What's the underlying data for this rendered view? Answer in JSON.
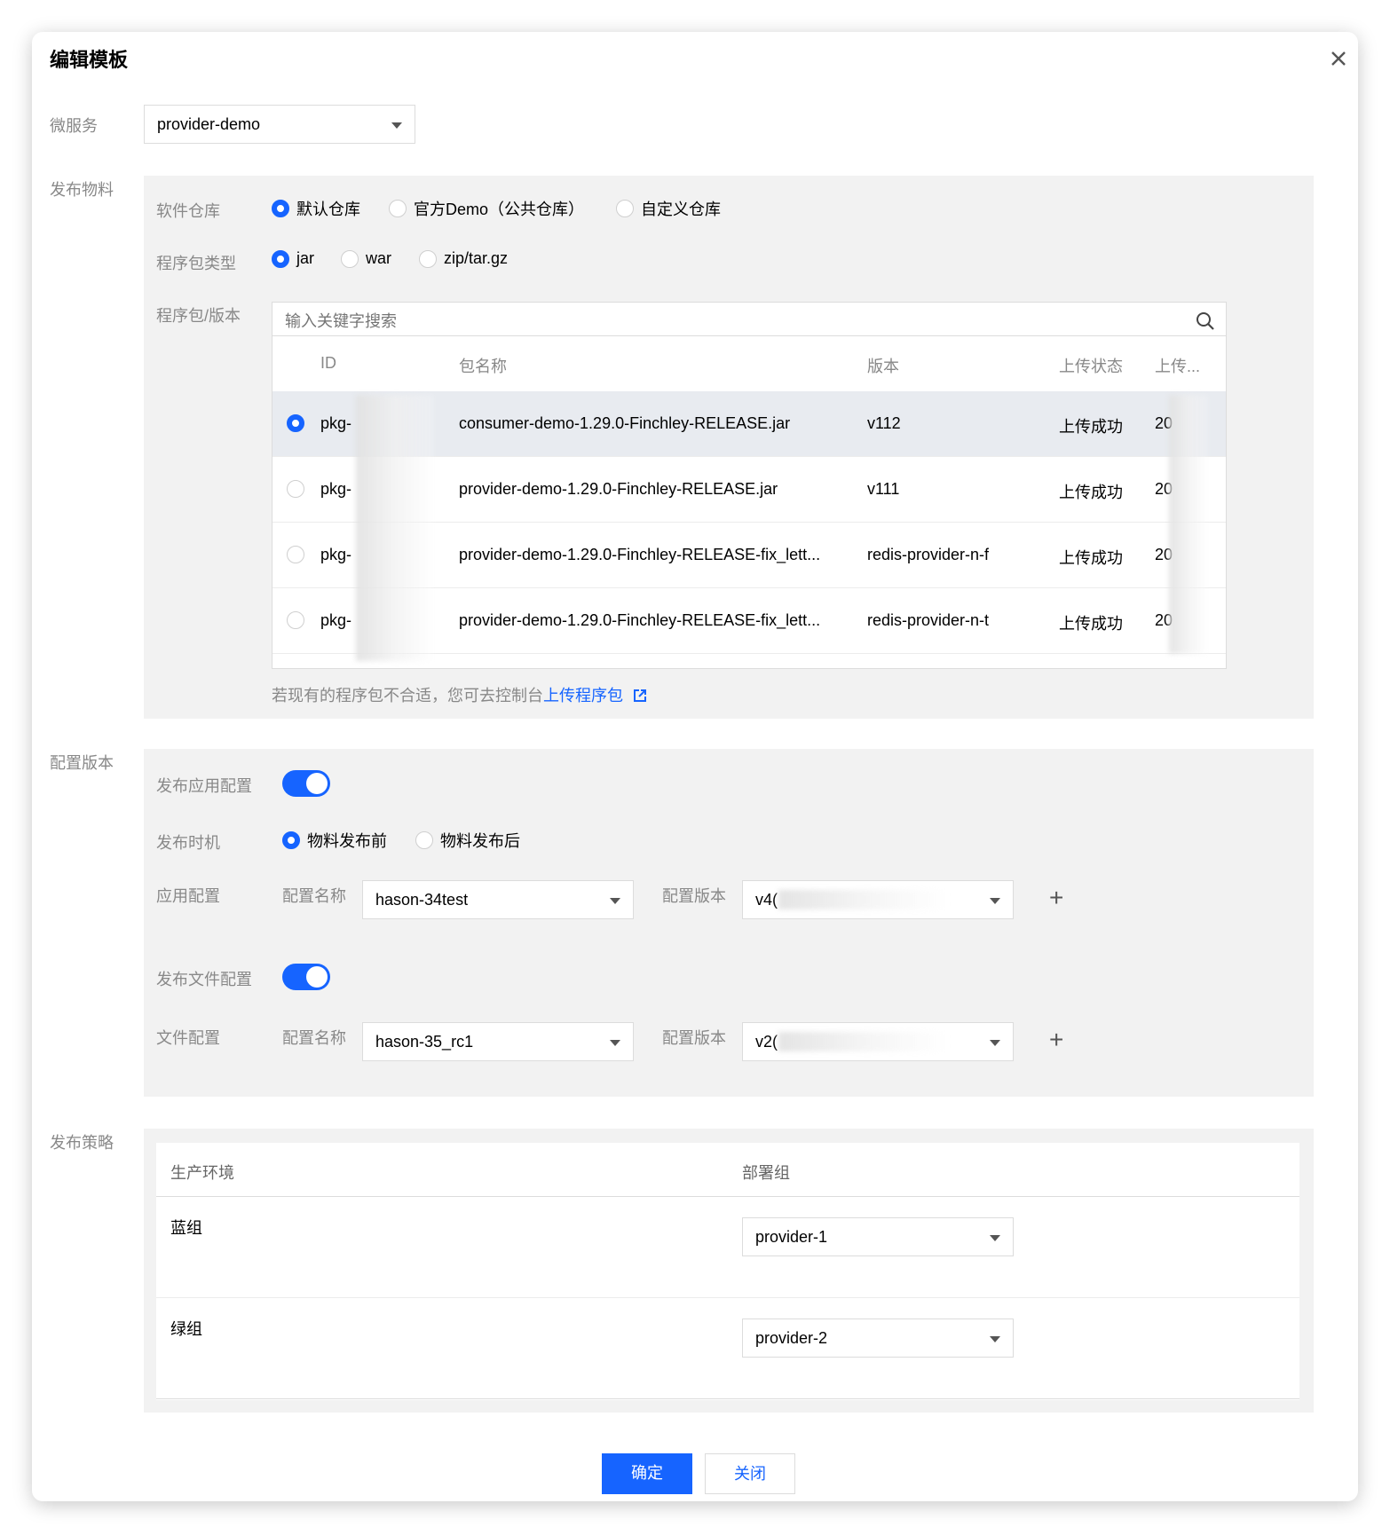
{
  "dialog": {
    "title": "编辑模板",
    "close_icon": "close-icon"
  },
  "microservice": {
    "label": "微服务",
    "value": "provider-demo"
  },
  "material": {
    "section_label": "发布物料",
    "repo": {
      "label": "软件仓库",
      "options": [
        "默认仓库",
        "官方Demo（公共仓库）",
        "自定义仓库"
      ],
      "selected": "默认仓库"
    },
    "pkg_type": {
      "label": "程序包类型",
      "options": [
        "jar",
        "war",
        "zip/tar.gz"
      ],
      "selected": "jar"
    },
    "pkg_version": {
      "label": "程序包/版本",
      "search_placeholder": "输入关键字搜索",
      "columns": [
        "ID",
        "包名称",
        "版本",
        "上传状态",
        "上传..."
      ],
      "rows": [
        {
          "id": "pkg-",
          "name": "consumer-demo-1.29.0-Finchley-RELEASE.jar",
          "version": "v112",
          "status": "上传成功",
          "time": "20",
          "selected": true
        },
        {
          "id": "pkg-",
          "name": "provider-demo-1.29.0-Finchley-RELEASE.jar",
          "version": "v111",
          "status": "上传成功",
          "time": "20",
          "selected": false
        },
        {
          "id": "pkg-",
          "name": "provider-demo-1.29.0-Finchley-RELEASE-fix_lett...",
          "version": "redis-provider-n-f",
          "status": "上传成功",
          "time": "20",
          "selected": false
        },
        {
          "id": "pkg-",
          "name": "provider-demo-1.29.0-Finchley-RELEASE-fix_lett...",
          "version": "redis-provider-n-t",
          "status": "上传成功",
          "time": "20",
          "selected": false
        }
      ]
    },
    "hint_text": "若现有的程序包不合适，您可去控制台",
    "hint_link": "上传程序包"
  },
  "config": {
    "section_label": "配置版本",
    "publish_app_config": {
      "label": "发布应用配置",
      "on": true
    },
    "timing": {
      "label": "发布时机",
      "options": [
        "物料发布前",
        "物料发布后"
      ],
      "selected": "物料发布前"
    },
    "app_config": {
      "label": "应用配置",
      "name_label": "配置名称",
      "name_value": "hason-34test",
      "version_label": "配置版本",
      "version_value": "v4("
    },
    "publish_file_config": {
      "label": "发布文件配置",
      "on": true
    },
    "file_config": {
      "label": "文件配置",
      "name_label": "配置名称",
      "name_value": "hason-35_rc1",
      "version_label": "配置版本",
      "version_value": "v2("
    }
  },
  "strategy": {
    "section_label": "发布策略",
    "columns": [
      "生产环境",
      "部署组"
    ],
    "rows": [
      {
        "env": "蓝组",
        "group": "provider-1"
      },
      {
        "env": "绿组",
        "group": "provider-2"
      }
    ]
  },
  "footer": {
    "confirm": "确定",
    "close": "关闭"
  },
  "colors": {
    "primary": "#1664ff",
    "panel_bg": "#f2f2f2",
    "label_gray": "#888888"
  }
}
